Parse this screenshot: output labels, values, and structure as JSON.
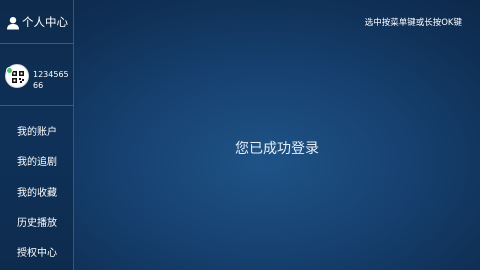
{
  "sidebar": {
    "title": "个人中心",
    "title_icon": "person-icon",
    "user": {
      "id": "123456566",
      "avatar": "avatar-qr-icon"
    },
    "items": [
      {
        "label": "我的账户"
      },
      {
        "label": "我的追剧"
      },
      {
        "label": "我的收藏"
      },
      {
        "label": "历史播放"
      },
      {
        "label": "授权中心"
      }
    ]
  },
  "header": {
    "hint": "选中按菜单键或长按OK键"
  },
  "main": {
    "message": "您已成功登录"
  },
  "colors": {
    "background": "#164170",
    "sidebar": "#0f3159",
    "divider": "#2e5f93",
    "status_online": "#4cc26a"
  }
}
